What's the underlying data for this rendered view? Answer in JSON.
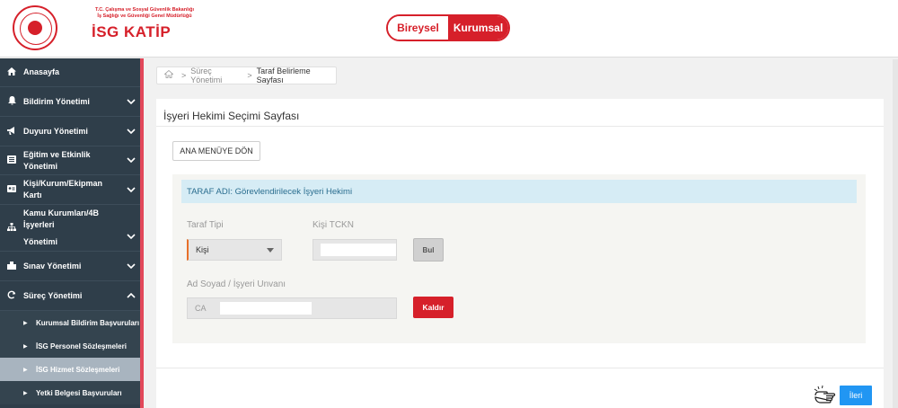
{
  "header": {
    "ministry_line1": "T.C. Çalışma ve Sosyal Güvenlik Bakanlığı",
    "ministry_line2": "İş Sağlığı ve Güvenliği Genel Müdürlüğü",
    "brand": "İSG KATİP",
    "toggle": {
      "bireysel": "Bireysel",
      "kurumsal": "Kurumsal",
      "active": "Kurumsal"
    },
    "colors": {
      "brand": "#d6202a"
    }
  },
  "sidebar": {
    "items": [
      {
        "label": "Anasayfa",
        "icon": "home-icon",
        "expandable": false
      },
      {
        "label": "Bildirim Yönetimi",
        "icon": "bell-icon",
        "expandable": true,
        "expanded": false
      },
      {
        "label": "Duyuru Yönetimi",
        "icon": "megaphone-icon",
        "expandable": true,
        "expanded": false
      },
      {
        "label": "Eğitim ve Etkinlik Yönetimi",
        "icon": "list-icon",
        "expandable": true,
        "expanded": false
      },
      {
        "label": "Kişi/Kurum/Ekipman Kartı",
        "icon": "id-card-icon",
        "expandable": true,
        "expanded": false
      },
      {
        "label_line1": "Kamu Kurumları/4B İşyerleri",
        "label_line2": "Yönetimi",
        "icon": "sitemap-icon",
        "expandable": true,
        "expanded": false
      },
      {
        "label": "Sınav Yönetimi",
        "icon": "exam-icon",
        "expandable": true,
        "expanded": false
      },
      {
        "label": "Süreç Yönetimi",
        "icon": "refresh-icon",
        "expandable": true,
        "expanded": true
      }
    ],
    "subitems": [
      {
        "label": "Kurumsal Bildirim Başvuruları",
        "active": false
      },
      {
        "label": "İSG Personel Sözleşmeleri",
        "active": false
      },
      {
        "label": "İSG Hizmet Sözleşmeleri",
        "active": true
      },
      {
        "label": "Yetki Belgesi Başvuruları",
        "active": false
      }
    ]
  },
  "breadcrumb": {
    "parent": "Süreç Yönetimi",
    "current": "Taraf Belirleme Sayfası"
  },
  "page": {
    "title": "İşyeri Hekimi Seçimi Sayfası",
    "menu_button": "ANA MENÜYE DÖN",
    "info": "TARAF ADI: Görevlendirilecek İşyeri Hekimi",
    "taraf_tipi_label": "Taraf Tipi",
    "taraf_tipi_value": "Kişi",
    "tckn_label": "Kişi TCKN",
    "bul_button": "Bul",
    "ad_soyad_label": "Ad Soyad / İşyeri Unvanı",
    "ad_soyad_prefix": "CA",
    "kaldir_button": "Kaldır",
    "ileri_button": "İleri"
  }
}
